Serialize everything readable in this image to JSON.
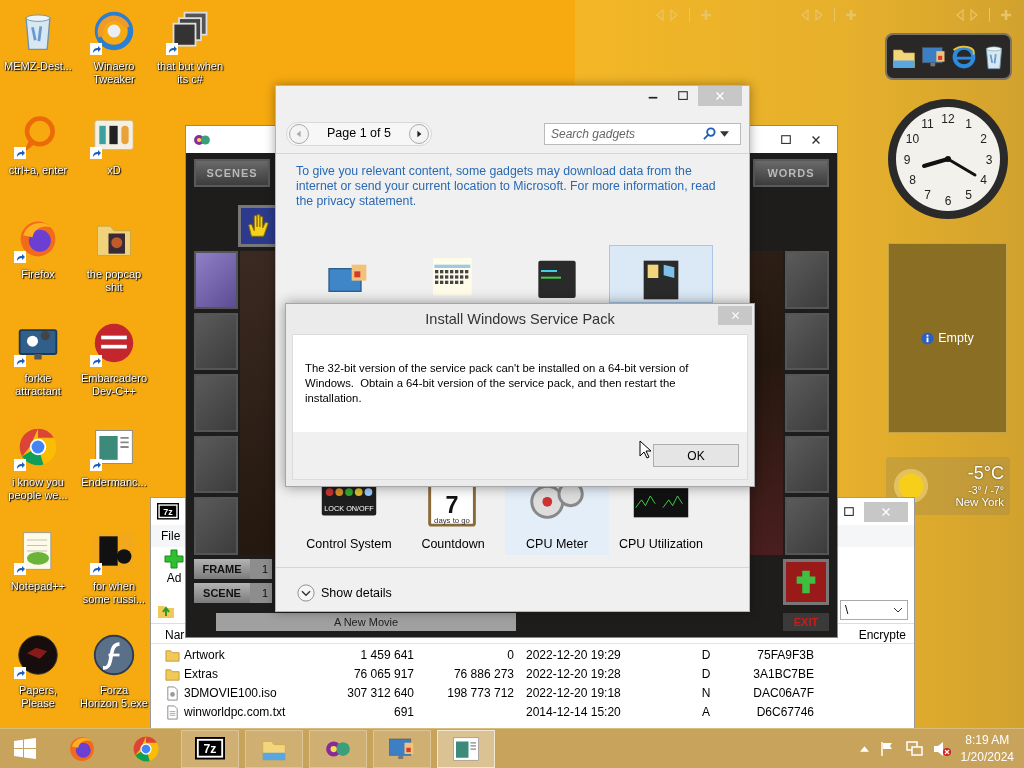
{
  "desktop_icon_rows": [
    [
      {
        "label": "MEMZ-Dest...",
        "kind": "recycle-bin",
        "shortcut": false
      },
      {
        "label": "Winaero Tweaker",
        "kind": "swirl",
        "shortcut": true
      },
      {
        "label": "that but when its c#",
        "kind": "stack",
        "shortcut": true
      }
    ],
    [
      {
        "label": "ctrl+a, enter",
        "kind": "ring",
        "shortcut": true
      },
      {
        "label": "xD",
        "kind": "hex-tile",
        "shortcut": true
      }
    ],
    [
      {
        "label": "Firefox",
        "kind": "firefox",
        "shortcut": true
      },
      {
        "label": "the popcap shit",
        "kind": "folder-art",
        "shortcut": false
      }
    ],
    [
      {
        "label": "forkie attractant",
        "kind": "monitor-gears",
        "shortcut": true
      },
      {
        "label": "Embarcadero Dev-C++",
        "kind": "red-disc",
        "shortcut": true
      }
    ],
    [
      {
        "label": "i know you people we...",
        "kind": "chrome",
        "shortcut": true
      },
      {
        "label": "Endermanc...",
        "kind": "app-window",
        "shortcut": true
      }
    ],
    [
      {
        "label": "Notepad++",
        "kind": "notepad",
        "shortcut": true
      },
      {
        "label": "for when some russi...",
        "kind": "orange-tile",
        "shortcut": true
      }
    ],
    [
      {
        "label": "Papers, Please",
        "kind": "dark-disc",
        "shortcut": true
      },
      {
        "label": "Forza Horizon 5.exe",
        "kind": "glossy-disc",
        "shortcut": false
      }
    ]
  ],
  "sidebar": {
    "clock": {
      "numerals": [
        "11",
        "12",
        "1",
        "10",
        "2",
        "9",
        "3",
        "8",
        "4",
        "7",
        "6",
        "5"
      ]
    },
    "slideshow": {
      "message": "Empty"
    },
    "weather": {
      "temperature": "-5°C",
      "range": "-3° / -7°",
      "city": "New York"
    }
  },
  "archive_window": {
    "logo_text": "7z",
    "menu": [
      "File"
    ],
    "toolbar": [
      "Ad"
    ],
    "path": "\\",
    "columns": [
      "Nar",
      "Encrypte"
    ],
    "rows": [
      {
        "kind": "folder",
        "name": "Artwork",
        "size": "1 459 641",
        "packed": "0",
        "modified": "2022-12-20 19:29",
        "attributes": "D",
        "crc": "75FA9F3B"
      },
      {
        "kind": "folder",
        "name": "Extras",
        "size": "76 065 917",
        "packed": "76 886 273",
        "modified": "2022-12-20 19:28",
        "attributes": "D",
        "crc": "3A1BC7BE"
      },
      {
        "kind": "disc-image",
        "name": "3DMOVIE100.iso",
        "size": "307 312 640",
        "packed": "198 773 712",
        "modified": "2022-12-20 19:18",
        "attributes": "N",
        "crc": "DAC06A7F"
      },
      {
        "kind": "text-file",
        "name": "winworldpc.com.txt",
        "size": "691",
        "modified": "2014-12-14 15:20",
        "attributes": "A",
        "crc": "D6C67746"
      }
    ]
  },
  "movie_maker": {
    "top_buttons": [
      "SCENES",
      "WORDS"
    ],
    "counters": [
      {
        "label": "FRAME",
        "value": "1"
      },
      {
        "label": "SCENE",
        "value": "1"
      }
    ],
    "movie_title": "A New Movie",
    "exit": "EXIT"
  },
  "gallery": {
    "page": "Page 1 of 5",
    "search_placeholder": "Search gadgets",
    "notice": "To give you relevant content, some gadgets may download data from the internet or send your current location to Microsoft. For more information, read the privacy statement.",
    "tiles": [
      {
        "kind": "slideshow",
        "selected": false,
        "hovered": false
      },
      {
        "kind": "calendar",
        "selected": false,
        "hovered": false
      },
      {
        "kind": "cpu-usage",
        "selected": false,
        "hovered": false
      },
      {
        "kind": "desktop-tools",
        "selected": false,
        "hovered": true
      },
      {
        "kind": "control-system",
        "label": "Control System",
        "caption": "LOCK ON/OFF",
        "selected": false,
        "hovered": false
      },
      {
        "kind": "countdown",
        "label": "Countdown",
        "number": "7",
        "caption": "days to go",
        "selected": false,
        "hovered": false
      },
      {
        "kind": "cpu-meter",
        "label": "CPU Meter",
        "selected": true,
        "hovered": false
      },
      {
        "kind": "cpu-utilization",
        "label": "CPU Utilization",
        "selected": false,
        "hovered": false
      }
    ],
    "details_toggle": "Show details"
  },
  "dialog": {
    "title": "Install Windows Service Pack",
    "message": "The 32-bit version of the service pack can't be installed on a 64-bit version of Windows.  Obtain a 64-bit version of the service pack, and then restart the installation.",
    "buttons": [
      "OK"
    ]
  },
  "taskbar": {
    "items": [
      {
        "kind": "firefox",
        "running": false,
        "selected": false
      },
      {
        "kind": "chrome",
        "running": false,
        "selected": false
      },
      {
        "kind": "archiver",
        "logo_text": "7z",
        "running": true,
        "selected": false
      },
      {
        "kind": "explorer",
        "running": true,
        "selected": false
      },
      {
        "kind": "movie-maker",
        "running": true,
        "selected": false
      },
      {
        "kind": "gadgets",
        "running": true,
        "selected": false
      },
      {
        "kind": "app-window",
        "running": true,
        "selected": true
      }
    ],
    "volume_muted": true,
    "time": "8:19 AM",
    "date": "1/20/2024"
  }
}
